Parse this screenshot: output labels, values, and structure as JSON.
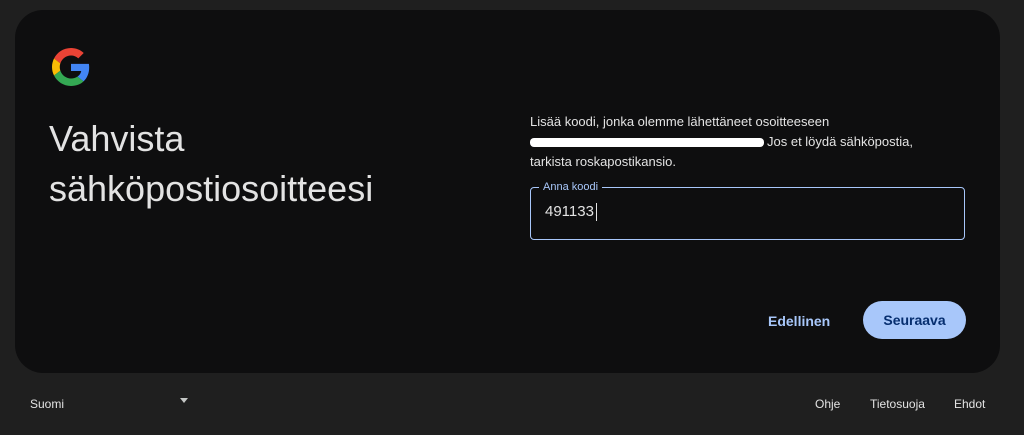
{
  "card": {
    "title_line1": "Vahvista",
    "title_line2": "sähköpostiosoitteesi",
    "desc_line1": "Lisää koodi, jonka olemme lähettäneet osoitteeseen",
    "desc_after_redaction": "Jos et löydä sähköpostia,",
    "desc_line3": "tarkista roskapostikansio."
  },
  "code_field": {
    "label": "Anna koodi",
    "value": "491133"
  },
  "buttons": {
    "back_label": "Edellinen",
    "next_label": "Seuraava"
  },
  "footer": {
    "language": "Suomi",
    "help": "Ohje",
    "privacy": "Tietosuoja",
    "terms": "Ehdot"
  },
  "icons": {
    "logo": "google-logo-icon",
    "language_dropdown": "dropdown-arrow-icon"
  },
  "colors": {
    "accent": "#a8c7fa",
    "card_bg": "#0e0e0f",
    "page_bg": "#1f1f1f"
  }
}
